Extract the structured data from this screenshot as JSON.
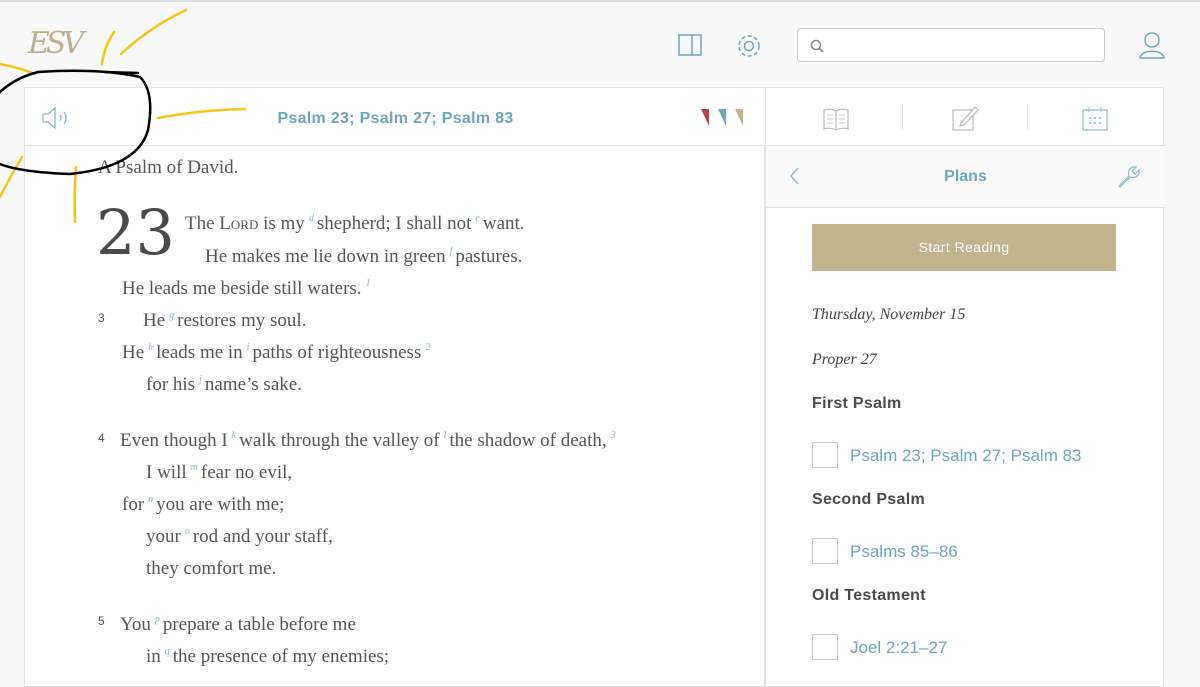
{
  "app": {
    "logo": "ESV"
  },
  "header": {
    "search_placeholder": "",
    "icons": [
      "layout-panel-icon",
      "gear-icon",
      "search-icon",
      "user-icon"
    ]
  },
  "reader": {
    "passage_title": "Psalm 23; Psalm 27; Psalm 83",
    "bookmark_colors": [
      "#b5434b",
      "#6fa5ba",
      "#c2b38f"
    ],
    "superscription": "A Psalm of David.",
    "chapter_number": "23",
    "verse_numbers": [
      "3",
      "4",
      "5"
    ],
    "lines": [
      [
        {
          "t": "The "
        },
        {
          "sc": "Lord"
        },
        {
          "t": " is my"
        },
        {
          "fn": "d"
        },
        {
          "t": "shepherd; I shall not"
        },
        {
          "fn": "e"
        },
        {
          "t": "want."
        }
      ],
      [
        {
          "t": "He makes me lie down in green"
        },
        {
          "fn": "f"
        },
        {
          "t": "pastures."
        }
      ],
      [
        {
          "t": "He leads me beside still waters."
        },
        {
          "fn": "1"
        }
      ],
      [
        {
          "t": "He"
        },
        {
          "fn": "g"
        },
        {
          "t": "restores my soul."
        }
      ],
      [
        {
          "t": "He"
        },
        {
          "fn": "h"
        },
        {
          "t": "leads me in"
        },
        {
          "fn": "i"
        },
        {
          "t": "paths of righteousness"
        },
        {
          "fn": "2"
        }
      ],
      [
        {
          "t": "for his"
        },
        {
          "fn": "j"
        },
        {
          "t": "name’s sake."
        }
      ],
      [
        {
          "t": "Even though I"
        },
        {
          "fn": "k"
        },
        {
          "t": "walk through the valley of"
        },
        {
          "fn": "l"
        },
        {
          "t": "the shadow of death,"
        },
        {
          "fn": "3"
        }
      ],
      [
        {
          "t": "I will"
        },
        {
          "fn": "m"
        },
        {
          "t": "fear no evil,"
        }
      ],
      [
        {
          "t": "for"
        },
        {
          "fn": "n"
        },
        {
          "t": "you are with me;"
        }
      ],
      [
        {
          "t": "your"
        },
        {
          "fn": "o"
        },
        {
          "t": "rod and your staff,"
        }
      ],
      [
        {
          "t": "they comfort me."
        }
      ],
      [
        {
          "t": "You"
        },
        {
          "fn": "p"
        },
        {
          "t": "prepare a table before me"
        }
      ],
      [
        {
          "t": "in"
        },
        {
          "fn": "q"
        },
        {
          "t": "the presence of my enemies;"
        }
      ]
    ]
  },
  "sidebar": {
    "title": "Plans",
    "start_button": "Start Reading",
    "date": "Thursday, November 15",
    "proper": "Proper 27",
    "sections": [
      {
        "heading": "First Psalm",
        "reading": "Psalm 23; Psalm 27; Psalm 83",
        "checked": false
      },
      {
        "heading": "Second Psalm",
        "reading": "Psalms 85–86",
        "checked": false
      },
      {
        "heading": "Old Testament",
        "reading": "Joel 2:21–27",
        "checked": false
      }
    ]
  },
  "colors": {
    "accent": "#6fa5ba",
    "gold": "#c2b38f",
    "annotation_yellow": "#f5c518",
    "annotation_black": "#000000"
  }
}
